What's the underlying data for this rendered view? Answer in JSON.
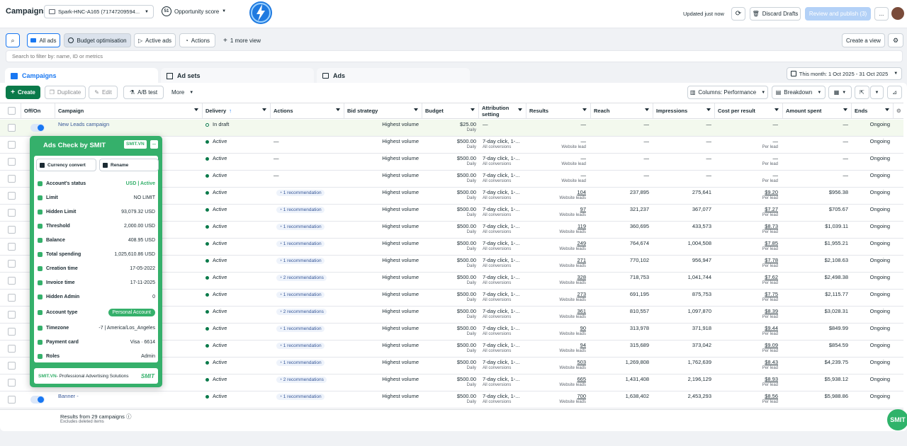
{
  "topbar": {
    "title": "Campaigns",
    "account": "Spark-HNC-A165 (71747209594...",
    "opp_badge": "51",
    "opp_label": "Opportunity score",
    "updated": "Updated just now",
    "discard": "Discard Drafts",
    "review": "Review and publish (3)",
    "more": "..."
  },
  "views": {
    "all_ads": "All ads",
    "budget": "Budget optimisation",
    "active_ads": "Active ads",
    "actions": "Actions",
    "more_view": "1 more view",
    "create_view": "Create a view",
    "search_placeholder": "Search to filter by: name, ID or metrics"
  },
  "tabs": {
    "campaigns": "Campaigns",
    "adsets": "Ad sets",
    "ads": "Ads"
  },
  "date_range": "This month: 1 Oct 2025 - 31 Oct 2025",
  "toolbar": {
    "create": "Create",
    "duplicate": "Duplicate",
    "edit": "Edit",
    "ab": "A/B test",
    "more": "More",
    "columns": "Columns: Performance",
    "breakdown": "Breakdown"
  },
  "headers": {
    "onoff": "Off/On",
    "campaign": "Campaign",
    "delivery": "Delivery",
    "actions": "Actions",
    "bid": "Bid strategy",
    "budget": "Budget",
    "attr1": "Attribution",
    "attr2": "setting",
    "results": "Results",
    "reach": "Reach",
    "impr": "Impressions",
    "cpr": "Cost per result",
    "spent": "Amount spent",
    "ends": "Ends"
  },
  "rows": [
    {
      "name": "New Leads campaign",
      "delivery": "In draft",
      "draft": true,
      "actions": "",
      "bid": "Highest volume",
      "budget": "$25.00",
      "budget_sub": "Daily",
      "attr": "—",
      "attr_sub": "",
      "results": "—",
      "results_sub": "",
      "reach": "—",
      "impr": "—",
      "cpr": "—",
      "cpr_sub": "",
      "spent": "—",
      "ends": "Ongoing"
    },
    {
      "name": "",
      "delivery": "Active",
      "actions": "—",
      "bid": "Highest volume",
      "budget": "$500.00",
      "budget_sub": "Daily",
      "attr": "7-day click, 1-...",
      "attr_sub": "All conversions",
      "results": "—",
      "results_sub": "Website lead",
      "reach": "—",
      "impr": "—",
      "cpr": "—",
      "cpr_sub": "Per lead",
      "spent": "—",
      "ends": "Ongoing"
    },
    {
      "name": "",
      "delivery": "Active",
      "actions": "—",
      "bid": "Highest volume",
      "budget": "$500.00",
      "budget_sub": "Daily",
      "attr": "7-day click, 1-...",
      "attr_sub": "All conversions",
      "results": "—",
      "results_sub": "Website lead",
      "reach": "—",
      "impr": "—",
      "cpr": "—",
      "cpr_sub": "Per lead",
      "spent": "—",
      "ends": "Ongoing"
    },
    {
      "name": "",
      "delivery": "Active",
      "actions": "—",
      "bid": "Highest volume",
      "budget": "$500.00",
      "budget_sub": "Daily",
      "attr": "7-day click, 1-...",
      "attr_sub": "All conversions",
      "results": "—",
      "results_sub": "Website lead",
      "reach": "—",
      "impr": "—",
      "cpr": "—",
      "cpr_sub": "Per lead",
      "spent": "—",
      "ends": "Ongoing"
    },
    {
      "name": "",
      "delivery": "Active",
      "actions": "1 recommendation",
      "bid": "Highest volume",
      "budget": "$500.00",
      "budget_sub": "Daily",
      "attr": "7-day click, 1-...",
      "attr_sub": "All conversions",
      "results": "104",
      "results_sub": "Website leads",
      "reach": "237,895",
      "impr": "275,641",
      "cpr": "$9.20",
      "cpr_sub": "Per lead",
      "spent": "$956.38",
      "ends": "Ongoing"
    },
    {
      "name": "",
      "delivery": "Active",
      "actions": "1 recommendation",
      "bid": "Highest volume",
      "budget": "$500.00",
      "budget_sub": "Daily",
      "attr": "7-day click, 1-...",
      "attr_sub": "All conversions",
      "results": "97",
      "results_sub": "Website leads",
      "reach": "321,237",
      "impr": "367,077",
      "cpr": "$7.27",
      "cpr_sub": "Per lead",
      "spent": "$705.67",
      "ends": "Ongoing"
    },
    {
      "name": "",
      "delivery": "Active",
      "actions": "1 recommendation",
      "bid": "Highest volume",
      "budget": "$500.00",
      "budget_sub": "Daily",
      "attr": "7-day click, 1-...",
      "attr_sub": "All conversions",
      "results": "119",
      "results_sub": "Website leads",
      "reach": "360,695",
      "impr": "433,573",
      "cpr": "$8.73",
      "cpr_sub": "Per lead",
      "spent": "$1,039.11",
      "ends": "Ongoing"
    },
    {
      "name": "",
      "delivery": "Active",
      "actions": "1 recommendation",
      "bid": "Highest volume",
      "budget": "$500.00",
      "budget_sub": "Daily",
      "attr": "7-day click, 1-...",
      "attr_sub": "All conversions",
      "results": "249",
      "results_sub": "Website leads",
      "reach": "764,674",
      "impr": "1,004,508",
      "cpr": "$7.85",
      "cpr_sub": "Per lead",
      "spent": "$1,955.21",
      "ends": "Ongoing"
    },
    {
      "name": "",
      "delivery": "Active",
      "actions": "1 recommendation",
      "bid": "Highest volume",
      "budget": "$500.00",
      "budget_sub": "Daily",
      "attr": "7-day click, 1-...",
      "attr_sub": "All conversions",
      "results": "271",
      "results_sub": "Website leads",
      "reach": "770,102",
      "impr": "956,947",
      "cpr": "$7.78",
      "cpr_sub": "Per lead",
      "spent": "$2,108.63",
      "ends": "Ongoing"
    },
    {
      "name": "",
      "delivery": "Active",
      "actions": "2 recommendations",
      "bid": "Highest volume",
      "budget": "$500.00",
      "budget_sub": "Daily",
      "attr": "7-day click, 1-...",
      "attr_sub": "All conversions",
      "results": "328",
      "results_sub": "Website leads",
      "reach": "718,753",
      "impr": "1,041,744",
      "cpr": "$7.62",
      "cpr_sub": "Per lead",
      "spent": "$2,498.38",
      "ends": "Ongoing"
    },
    {
      "name": "",
      "delivery": "Active",
      "actions": "1 recommendation",
      "bid": "Highest volume",
      "budget": "$500.00",
      "budget_sub": "Daily",
      "attr": "7-day click, 1-...",
      "attr_sub": "All conversions",
      "results": "273",
      "results_sub": "Website leads",
      "reach": "691,195",
      "impr": "875,753",
      "cpr": "$7.75",
      "cpr_sub": "Per lead",
      "spent": "$2,115.77",
      "ends": "Ongoing"
    },
    {
      "name": "",
      "delivery": "Active",
      "actions": "2 recommendations",
      "bid": "Highest volume",
      "budget": "$500.00",
      "budget_sub": "Daily",
      "attr": "7-day click, 1-...",
      "attr_sub": "All conversions",
      "results": "361",
      "results_sub": "Website leads",
      "reach": "810,557",
      "impr": "1,097,870",
      "cpr": "$8.39",
      "cpr_sub": "Per lead",
      "spent": "$3,028.31",
      "ends": "Ongoing"
    },
    {
      "name": "",
      "delivery": "Active",
      "actions": "1 recommendation",
      "bid": "Highest volume",
      "budget": "$500.00",
      "budget_sub": "Daily",
      "attr": "7-day click, 1-...",
      "attr_sub": "All conversions",
      "results": "90",
      "results_sub": "Website leads",
      "reach": "313,978",
      "impr": "371,918",
      "cpr": "$9.44",
      "cpr_sub": "Per lead",
      "spent": "$849.99",
      "ends": "Ongoing"
    },
    {
      "name": "",
      "delivery": "Active",
      "actions": "1 recommendation",
      "bid": "Highest volume",
      "budget": "$500.00",
      "budget_sub": "Daily",
      "attr": "7-day click, 1-...",
      "attr_sub": "All conversions",
      "results": "94",
      "results_sub": "Website leads",
      "reach": "315,689",
      "impr": "373,042",
      "cpr": "$9.09",
      "cpr_sub": "Per lead",
      "spent": "$854.59",
      "ends": "Ongoing"
    },
    {
      "name": "",
      "delivery": "Active",
      "actions": "1 recommendation",
      "bid": "Highest volume",
      "budget": "$500.00",
      "budget_sub": "Daily",
      "attr": "7-day click, 1-...",
      "attr_sub": "All conversions",
      "results": "503",
      "results_sub": "Website leads",
      "reach": "1,269,808",
      "impr": "1,762,639",
      "cpr": "$8.43",
      "cpr_sub": "Per lead",
      "spent": "$4,239.75",
      "ends": "Ongoing"
    },
    {
      "name": "",
      "delivery": "Active",
      "actions": "2 recommendations",
      "bid": "Highest volume",
      "budget": "$500.00",
      "budget_sub": "Daily",
      "attr": "7-day click, 1-...",
      "attr_sub": "All conversions",
      "results": "665",
      "results_sub": "Website leads",
      "reach": "1,431,408",
      "impr": "2,196,129",
      "cpr": "$8.93",
      "cpr_sub": "Per lead",
      "spent": "$5,938.12",
      "ends": "Ongoing"
    },
    {
      "name": "Banner -",
      "delivery": "Active",
      "actions": "1 recommendation",
      "bid": "Highest volume",
      "budget": "$500.00",
      "budget_sub": "Daily",
      "attr": "7-day click, 1-...",
      "attr_sub": "All conversions",
      "results": "700",
      "results_sub": "Website leads",
      "reach": "1,638,402",
      "impr": "2,453,293",
      "cpr": "$8.56",
      "cpr_sub": "Per lead",
      "spent": "$5,988.86",
      "ends": "Ongoing"
    }
  ],
  "footer": {
    "results": "Results from 29 campaigns",
    "excludes": "Excludes deleted items"
  },
  "popup": {
    "title": "Ads Check by SMIT",
    "brand": "SMIT.VN",
    "currency": "Currency convert",
    "rename": "Rename",
    "rows": [
      {
        "label": "Account's status",
        "value": "USD | Active"
      },
      {
        "label": "Limit",
        "value": "NO LIMIT"
      },
      {
        "label": "Hidden Limit",
        "value": "93,079.32 USD"
      },
      {
        "label": "Threshold",
        "value": "2,000.00 USD"
      },
      {
        "label": "Balance",
        "value": "408.95 USD"
      },
      {
        "label": "Total spending",
        "value": "1,025,610.86 USD"
      },
      {
        "label": "Creation time",
        "value": "17-05-2022"
      },
      {
        "label": "Invoice time",
        "value": "17-11-2025"
      },
      {
        "label": "Hidden Admin",
        "value": "0"
      },
      {
        "label": "Account type",
        "value": "Personal Account"
      },
      {
        "label": "Timezone",
        "value": "-7 | America/Los_Angeles"
      },
      {
        "label": "Payment card",
        "value": "Visa · 6614"
      },
      {
        "label": "Roles",
        "value": "Admin"
      }
    ],
    "footer_brand": "SMIT.VN",
    "footer_text": " - Professional Advertising Solutions",
    "footer_logo": "SMIT"
  },
  "fab": "SMIT",
  "colors": {
    "accent": "#1877f2",
    "create_green": "#0a7a4a",
    "smit_green": "#35b06b",
    "link": "#385898"
  }
}
